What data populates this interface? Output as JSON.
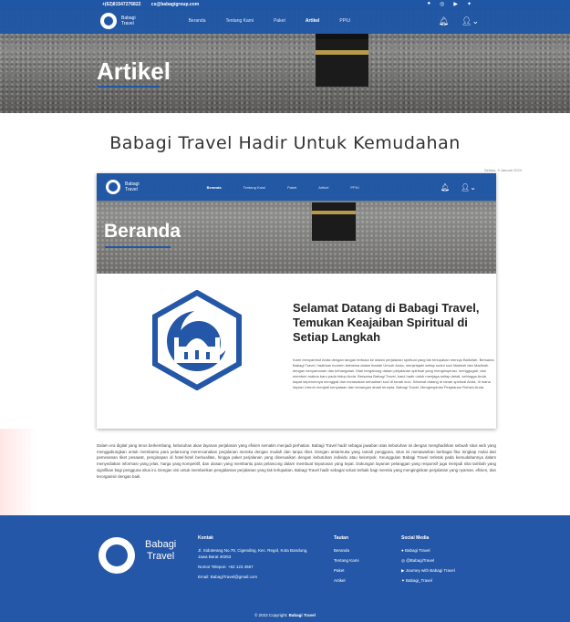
{
  "topbar": {
    "phone": "+(62)81547276822",
    "email": "cs@babagigroup.com",
    "social_icons": [
      "whatsapp-icon",
      "instagram-icon",
      "youtube-icon",
      "twitter-icon"
    ]
  },
  "brand": {
    "line1": "Babagi",
    "line2": "Travel"
  },
  "nav": {
    "items": [
      "Beranda",
      "Tentang Kami",
      "Paket",
      "Artikel",
      "PPIU"
    ],
    "active": "Artikel"
  },
  "hero": {
    "title": "Artikel"
  },
  "article": {
    "title": "Babagi Travel Hadir Untuk Kemudahan",
    "date": "Selasa, 9 Januari 2024",
    "body": "Dalam era digital yang terus berkembang, kebutuhan akan layanan perjalanan yang efisien semakin menjadi perhatian. Babagi Travel hadir sebagai jawaban atas kebutuhan ini dengan menghadirkan sebuah situs web yang menggabungkan untuk membantu para pelancong merencanakan perjalanan mereka dengan mudah dan tanpa ribet. Dengan antarmuka yang ramah pengguna, situs ini menawarkan berbagai fitur lengkap mulai dari pemesanan tiket pesawat, penginapan di hotel-hotel berkualitas, hingga paket perjalanan yang disesuaikan dengan kebutuhan individu atau kelompok. Keunggulan Babagi Travel terletak pada kemudahannya dalam menyediakan informasi yang jelas, harga yang kompetitif, dan ulasan yang membantu para pelancong dalam membuat keputusan yang tepat. Dukungan layanan pelanggan yang responsif juga menjadi nilai tambah yang signifikan bagi pengguna situs ini. Dengan visi untuk memberikan pengalaman perjalanan yang tak terlupakan, Babagi Travel hadir sebagai solusi terbaik bagi mereka yang menginginkan perjalanan yang nyaman, efisien, dan terorganisir dengan baik."
  },
  "screenshot": {
    "brand_line1": "Babagi",
    "brand_line2": "Travel",
    "nav_items": [
      "Beranda",
      "Tentang Kami",
      "Paket",
      "Artikel",
      "PPIU"
    ],
    "hero_title": "Beranda",
    "welcome_title": "Selamat Datang di Babagi Travel, Temukan Keajaiban Spiritual di Setiap Langkah",
    "welcome_text": "Kami menyambut Anda dengan tangan terbuka ke dalam perjalanan spiritual yang tak terlupakan menuju Baitullah. Bersama Babagi Travel, hadirkan momen istimewa dalam ibadah Umroh Anda, menjelajahi setiap sudut suci Makkah dan Madinah dengan kenyamanan dan kehangatan. Mari bergabung dalam perjalanan spiritual yang menginspirasi, menggugah, dan memberi makna baru pada hidup Anda. Bersama Babagi Travel, kami hadir untuk menjaga setiap detail, sehingga Anda dapat sepenuhnya menggali dan merasakan kehadiran suci di tanah suci. Selamat datang di ranah spiritual Anda, di mana impian Umroh menjadi kenyataan dan kenangan abadi tercipta. Babagi Travel, Menginspirasi Perjalanan Rohani Anda."
  },
  "footer": {
    "brand_line1": "Babagi",
    "brand_line2": "Travel",
    "kontak": {
      "heading": "Kontak",
      "address": "Jl. Sidoterang No.78, Cigending, Kec. Regol, Kota Bandung, Jawa Barat 40253",
      "phone": "Nomor Telepon: +62 123 4567",
      "email": "Email: BabagiTravel@gmail.com"
    },
    "tautan": {
      "heading": "Tautan",
      "links": [
        "Beranda",
        "Tentang Kami",
        "Paket",
        "Artikel"
      ]
    },
    "social": {
      "heading": "Social Media",
      "items": [
        "Babagi Travel",
        "@BabagiTravel",
        "Journey with Babagi Travel",
        "Babagi_Travel"
      ]
    },
    "copyright_prefix": "© 2023 Copyright:",
    "copyright_brand": "Babagi Travel"
  },
  "colors": {
    "primary": "#1f56a6",
    "footer": "#2457a7"
  }
}
